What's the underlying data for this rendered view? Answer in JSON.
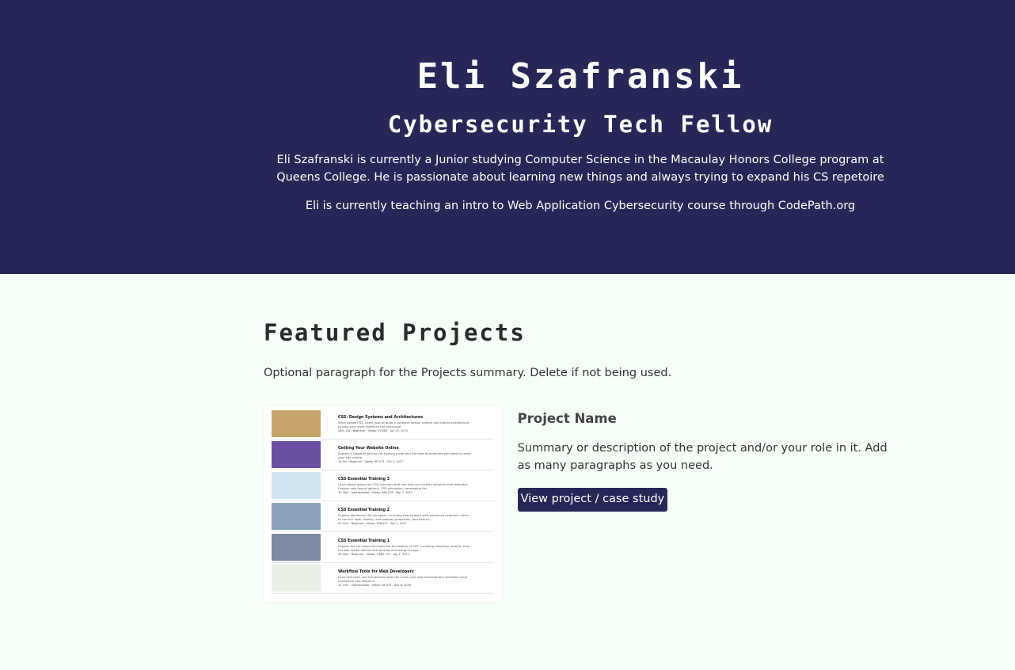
{
  "hero": {
    "name": "Eli Szafranski",
    "role": "Cybersecurity Tech Fellow",
    "bio": "Eli Szafranski is currently a Junior studying Computer Science in the Macaulay Honors College program at Queens College. He is passionate about learning new things and always trying to expand his CS repetoire",
    "teaching": "Eli is currently teaching an intro to Web Application Cybersecurity course through CodePath.org"
  },
  "projects": {
    "title": "Featured Projects",
    "summary": "Optional paragraph for the Projects summary. Delete if not being used.",
    "items": [
      {
        "name": "Project Name",
        "description": "Summary or description of the project and/or your role in it. Add as many paragraphs as you need.",
        "button_label": "View project / case study",
        "courses": [
          {
            "title": "CSS: Design Systems and Architectures",
            "desc": "Write better CSS. Learn how to build a cohesive design system and robust architecture to take your style sheets to the next level.",
            "meta": "58m 13s  ·  Beginner  ·  Views: 29,584  ·  Jun 19, 2019",
            "color": "#c7a46b"
          },
          {
            "title": "Getting Your Website Online",
            "desc": "Explore a range of options for hosting a site and the core foundations you need to make your site visible.",
            "meta": "1h 5m  ·  Beginner  ·  Views: 99,573  ·  Oct 3, 2017",
            "color": "#6a4fa3"
          },
          {
            "title": "CSS Essential Training 3",
            "desc": "Learn about advanced CSS concepts that can help you further enhance your websites. Explore new layout options, CSS animation, developing for...",
            "meta": "1h 30m  ·  Intermediate  ·  Views: 264,278  ·  Sep 7, 2017",
            "color": "#cfe6f2"
          },
          {
            "title": "CSS Essential Training 2",
            "desc": "Explore advanced CSS concepts, including how to work with advanced selectors, when to use the float, display, and position properties, and how to...",
            "meta": "2h 21m  ·  Beginner  ·  Views: 706,017  ·  Apr 1, 2017",
            "color": "#8aa3b8"
          },
          {
            "title": "CSS Essential Training 1",
            "desc": "Explore the concepts that form the foundation of CSS, including selecting content, how the box model defines the spacing and sizing of page...",
            "meta": "2h 30m  ·  Beginner  ·  Views: 1,665,775  ·  Apr 1, 2017",
            "color": "#7b8aa0"
          },
          {
            "title": "Workflow Tools for Web Developers",
            "desc": "Learn the tools and frameworks that can make your web development workflow more productive and efficient.",
            "meta": "1h 15m  ·  Intermediate  ·  Views: 98,437  ·  Dec 8, 2016",
            "color": "#e9f1e6"
          }
        ]
      }
    ]
  },
  "colors": {
    "hero_bg": "#272757",
    "page_bg": "#f5fff8",
    "button_bg": "#272757"
  }
}
